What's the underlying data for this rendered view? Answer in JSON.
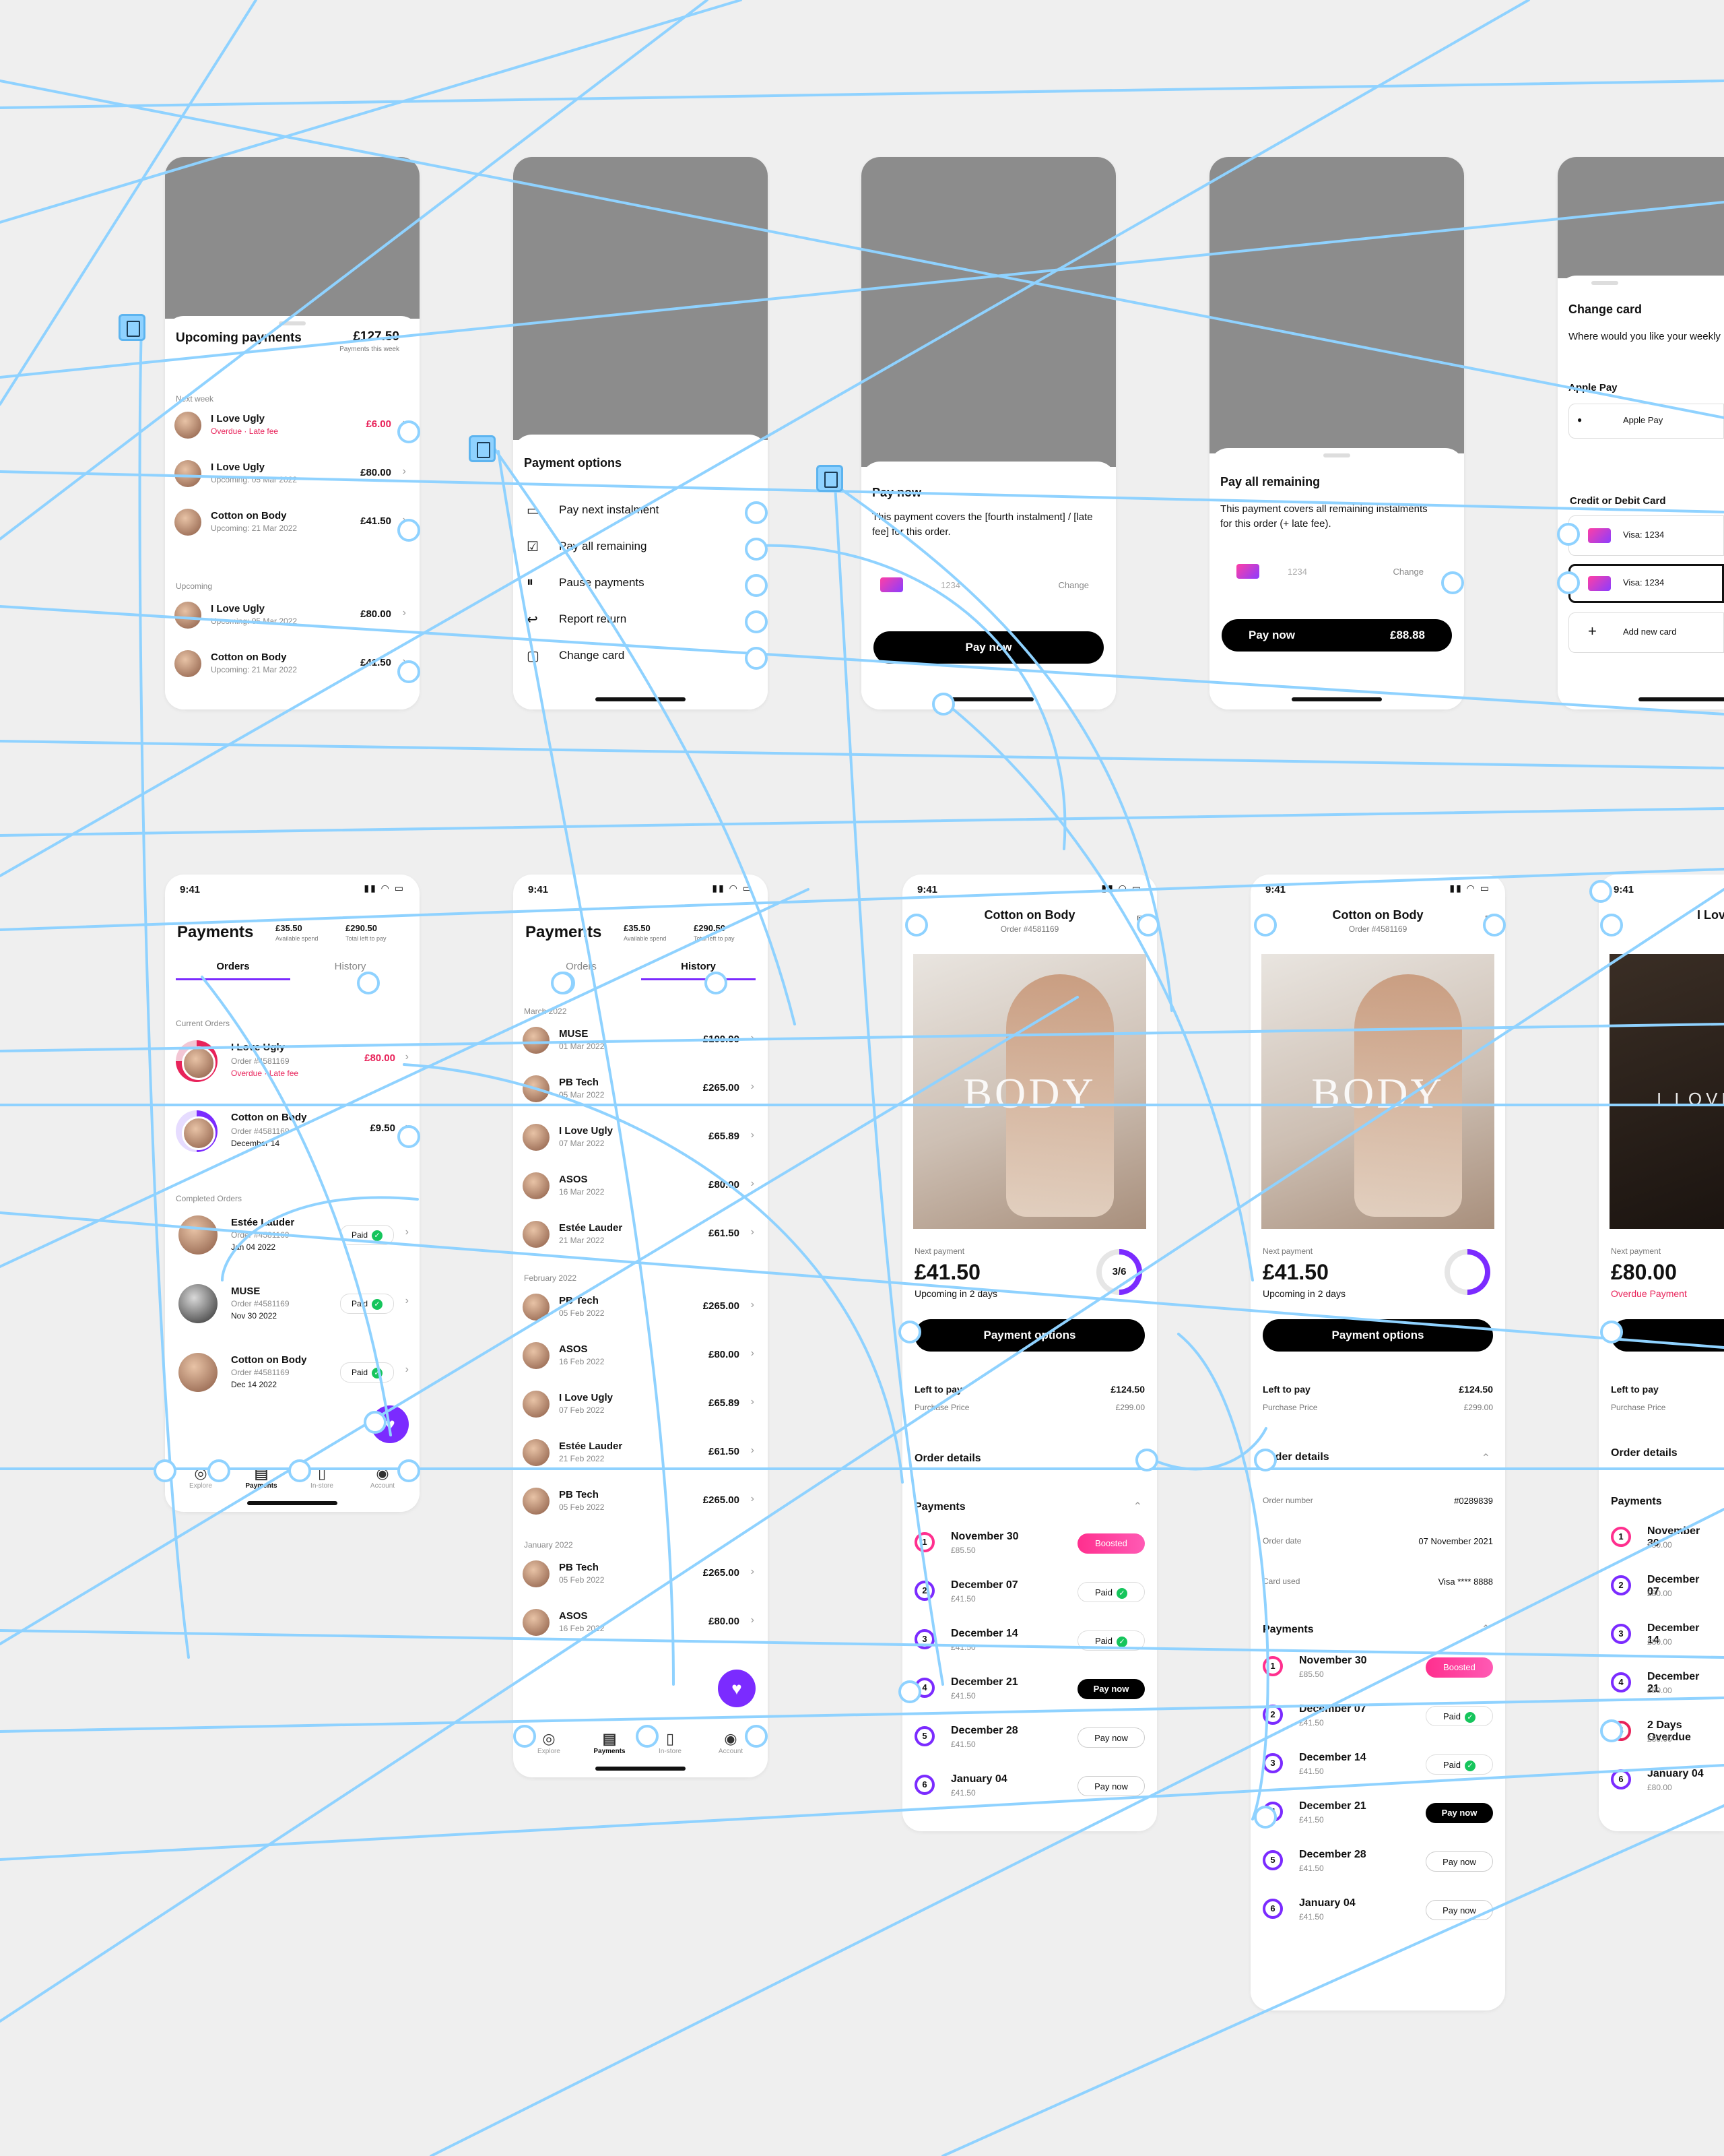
{
  "colors": {
    "canvas_bg": "#efefef",
    "wire": "#8fd2ff",
    "accent_purple": "#7b2bff",
    "accent_pink": "#ff2f8e",
    "overdue_red": "#e8235a",
    "paid_green": "#16c55c"
  },
  "upcoming_payments": {
    "title": "Upcoming payments",
    "total": "£127.50",
    "total_label": "Payments this week",
    "section_next_week": "Next week",
    "section_upcoming": "Upcoming",
    "rows": [
      {
        "name": "I Love Ugly",
        "sub": "Overdue · Late fee",
        "amount": "£6.00",
        "overdue": true
      },
      {
        "name": "I Love Ugly",
        "sub": "Upcoming: 05 Mar 2022",
        "amount": "£80.00"
      },
      {
        "name": "Cotton on Body",
        "sub": "Upcoming: 21 Mar 2022",
        "amount": "£41.50"
      },
      {
        "name": "I Love Ugly",
        "sub": "Upcoming: 05 Mar 2022",
        "amount": "£80.00"
      },
      {
        "name": "Cotton on Body",
        "sub": "Upcoming: 21 Mar 2022",
        "amount": "£41.50"
      }
    ]
  },
  "payment_options": {
    "title": "Payment options",
    "items": [
      {
        "label": "Pay next instalment",
        "icon": "wallet-icon"
      },
      {
        "label": "Pay all remaining",
        "icon": "checkbox-icon"
      },
      {
        "label": "Pause payments",
        "icon": "pause-icon"
      },
      {
        "label": "Report return",
        "icon": "return-icon"
      },
      {
        "label": "Change card",
        "icon": "card-icon"
      }
    ]
  },
  "pay_now": {
    "title": "Pay now",
    "body": "This payment covers the [fourth instalment] / [late fee] for this order.",
    "card_number": "1234",
    "change": "Change",
    "button": "Pay now"
  },
  "pay_all": {
    "title": "Pay all remaining",
    "body": "This payment covers all remaining instalments for this order (+ late fee).",
    "card_number": "1234",
    "change": "Change",
    "button_left": "Pay now",
    "button_right": "£88.88"
  },
  "change_card": {
    "title": "Change card",
    "body": "Where would you like your weekly payments charged?",
    "apple_pay_section": "Apple Pay",
    "apple_pay_item": "Apple Pay",
    "card_section": "Credit or Debit Card",
    "cards": [
      "Visa: 1234",
      "Visa: 1234"
    ],
    "add_new": "Add new card"
  },
  "payments_orders": {
    "time": "9:41",
    "title": "Payments",
    "available": "£35.50",
    "available_label": "Available spend",
    "left": "£290.50",
    "left_label": "Total left to pay",
    "tabs": [
      "Orders",
      "History"
    ],
    "current_label": "Current Orders",
    "completed_label": "Completed Orders",
    "current": [
      {
        "name": "I Love Ugly",
        "order": "Order #4581169",
        "sub": "Overdue · Late fee",
        "amount": "£80.00",
        "overdue": true
      },
      {
        "name": "Cotton on Body",
        "order": "Order #4581169",
        "sub": "December 14",
        "amount": "£9.50"
      }
    ],
    "completed": [
      {
        "name": "Estée Lauder",
        "order": "Order #4581169",
        "sub": "Jan 04 2022",
        "status": "Paid"
      },
      {
        "name": "MUSE",
        "order": "Order #4581169",
        "sub": "Nov 30 2022",
        "status": "Paid"
      },
      {
        "name": "Cotton on Body",
        "order": "Order #4581169",
        "sub": "Dec 14 2022",
        "status": "Paid"
      }
    ],
    "nav": [
      "Explore",
      "Payments",
      "In-store",
      "Account"
    ]
  },
  "payments_history": {
    "time": "9:41",
    "title": "Payments",
    "available": "£35.50",
    "available_label": "Available spend",
    "left": "£290.50",
    "left_label": "Total left to pay",
    "tabs": [
      "Orders",
      "History"
    ],
    "groups": [
      {
        "month": "March 2022",
        "items": [
          {
            "name": "MUSE",
            "date": "01 Mar 2022",
            "amount": "£100.00"
          },
          {
            "name": "PB Tech",
            "date": "05 Mar 2022",
            "amount": "£265.00"
          },
          {
            "name": "I Love Ugly",
            "date": "07 Mar 2022",
            "amount": "£65.89"
          },
          {
            "name": "ASOS",
            "date": "16 Mar 2022",
            "amount": "£80.00"
          },
          {
            "name": "Estée Lauder",
            "date": "21 Mar 2022",
            "amount": "£61.50"
          }
        ]
      },
      {
        "month": "February 2022",
        "items": [
          {
            "name": "PB Tech",
            "date": "05 Feb 2022",
            "amount": "£265.00"
          },
          {
            "name": "ASOS",
            "date": "16 Feb 2022",
            "amount": "£80.00"
          },
          {
            "name": "I Love Ugly",
            "date": "07 Feb 2022",
            "amount": "£65.89"
          },
          {
            "name": "Estée Lauder",
            "date": "21 Feb 2022",
            "amount": "£61.50"
          },
          {
            "name": "PB Tech",
            "date": "05 Feb 2022",
            "amount": "£265.00"
          }
        ]
      },
      {
        "month": "January 2022",
        "items": [
          {
            "name": "PB Tech",
            "date": "05 Feb 2022",
            "amount": "£265.00"
          },
          {
            "name": "ASOS",
            "date": "16 Feb 2022",
            "amount": "£80.00"
          }
        ]
      }
    ],
    "nav": [
      "Explore",
      "Payments",
      "In-store",
      "Account"
    ]
  },
  "order_detail_a": {
    "time": "9:41",
    "title": "Cotton on Body",
    "order": "Order #4581169",
    "brand": "BODY",
    "next_label": "Next payment",
    "next_amount": "£41.50",
    "next_sub": "Upcoming in 2 days",
    "progress": "3/6",
    "progress_fraction": 0.5,
    "button": "Payment options",
    "left_label": "Left to pay",
    "left_value": "£124.50",
    "purchase_label": "Purchase Price",
    "purchase_value": "£299.00",
    "details_label": "Order details",
    "payments_label": "Payments",
    "instalments": [
      {
        "n": "1",
        "date": "November 30",
        "amt": "£85.50",
        "status": "Boosted",
        "kind": "boost"
      },
      {
        "n": "2",
        "date": "December 07",
        "amt": "£41.50",
        "status": "Paid",
        "kind": "paid"
      },
      {
        "n": "3",
        "date": "December 14",
        "amt": "£41.50",
        "status": "Paid",
        "kind": "paid"
      },
      {
        "n": "4",
        "date": "December 21",
        "amt": "£41.50",
        "status": "Pay now",
        "kind": "black"
      },
      {
        "n": "5",
        "date": "December 28",
        "amt": "£41.50",
        "status": "Pay now",
        "kind": "outline"
      },
      {
        "n": "6",
        "date": "January 04",
        "amt": "£41.50",
        "status": "Pay now",
        "kind": "outline"
      }
    ]
  },
  "order_detail_b": {
    "time": "9:41",
    "title": "Cotton on Body",
    "order": "Order #4581169",
    "brand": "BODY",
    "next_label": "Next payment",
    "next_amount": "£41.50",
    "next_sub": "Upcoming in 2 days",
    "button": "Payment options",
    "left_label": "Left to pay",
    "left_value": "£124.50",
    "purchase_label": "Purchase Price",
    "purchase_value": "£299.00",
    "details_label": "Order details",
    "details": [
      {
        "k": "Order number",
        "v": "#0289839"
      },
      {
        "k": "Order date",
        "v": "07 November 2021"
      },
      {
        "k": "Card used",
        "v": "Visa **** 8888"
      }
    ],
    "payments_label": "Payments",
    "instalments": [
      {
        "n": "1",
        "date": "November 30",
        "amt": "£85.50",
        "status": "Boosted",
        "kind": "boost"
      },
      {
        "n": "2",
        "date": "December 07",
        "amt": "£41.50",
        "status": "Paid",
        "kind": "paid"
      },
      {
        "n": "3",
        "date": "December 14",
        "amt": "£41.50",
        "status": "Paid",
        "kind": "paid"
      },
      {
        "n": "4",
        "date": "December 21",
        "amt": "£41.50",
        "status": "Pay now",
        "kind": "black"
      },
      {
        "n": "5",
        "date": "December 28",
        "amt": "£41.50",
        "status": "Pay now",
        "kind": "outline"
      },
      {
        "n": "6",
        "date": "January 04",
        "amt": "£41.50",
        "status": "Pay now",
        "kind": "outline"
      }
    ]
  },
  "order_detail_c": {
    "time": "9:41",
    "title": "I Love Ugly",
    "brand": "I LOVE",
    "next_label": "Next payment",
    "next_amount": "£80.00",
    "next_sub": "Overdue Payment",
    "left_label": "Left to pay",
    "purchase_label": "Purchase Price",
    "details_label": "Order details",
    "payments_label": "Payments",
    "instalments": [
      {
        "n": "1",
        "date": "November 30",
        "amt": "£80.00"
      },
      {
        "n": "2",
        "date": "December 07",
        "amt": "£80.00"
      },
      {
        "n": "3",
        "date": "December 14",
        "amt": "£80.00"
      },
      {
        "n": "4",
        "date": "December 21",
        "amt": "£80.00"
      },
      {
        "n": "5",
        "date": "2 Days Overdue",
        "amt": "£80.00"
      },
      {
        "n": "6",
        "date": "January 04",
        "amt": "£80.00"
      }
    ]
  }
}
